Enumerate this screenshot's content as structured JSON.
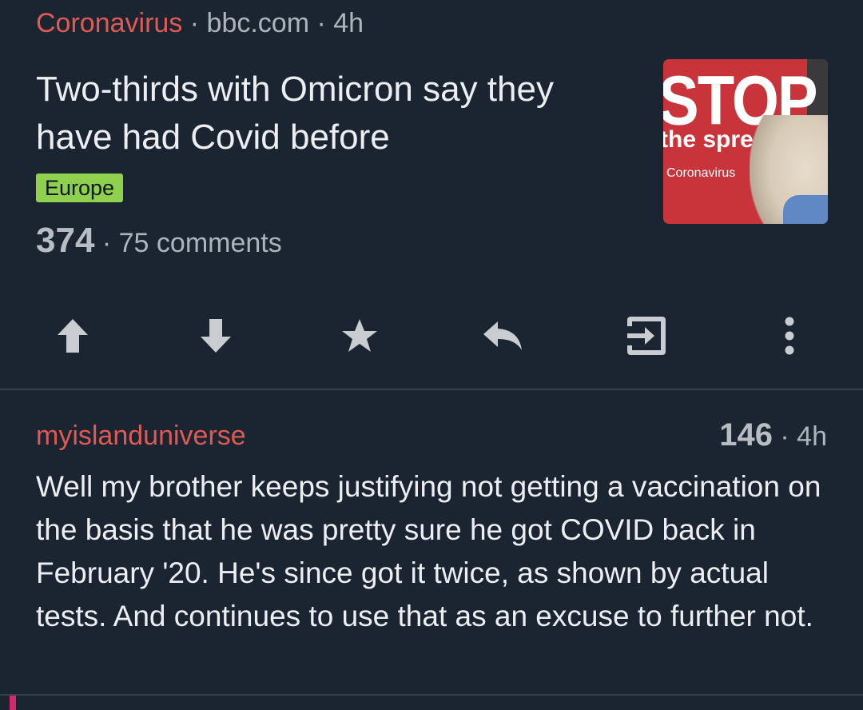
{
  "post": {
    "subreddit": "Coronavirus",
    "sep1": " · ",
    "domain": "bbc.com",
    "sep2": " · ",
    "age": "4h",
    "title": "Two-thirds with Omicron say they have had Covid before",
    "flair": "Europe",
    "score": "374",
    "sep3": " · ",
    "comments": "75 comments",
    "thumbnail": {
      "text_stop": "STOP",
      "text_spread": "the spread",
      "text_corona": "Coronavirus"
    }
  },
  "actions": [
    {
      "name": "upvote-icon"
    },
    {
      "name": "downvote-icon"
    },
    {
      "name": "star-icon"
    },
    {
      "name": "reply-icon"
    },
    {
      "name": "open-link-icon"
    },
    {
      "name": "more-vertical-icon"
    }
  ],
  "comment": {
    "author": "myislanduniverse",
    "score": "146",
    "sep": " · ",
    "age": "4h",
    "body": "Well my brother keeps justifying not getting a vaccination on the basis that he was pretty sure he got COVID back in February '20. He's since got it twice, as shown by actual tests. And continues to use that as an excuse to further not."
  },
  "colors": {
    "background": "#1b2531",
    "accent_red": "#e05a55",
    "flair_green": "#8fd14f",
    "icon_gray": "#c9ccd0",
    "thread_accent": "#d12b6c"
  }
}
